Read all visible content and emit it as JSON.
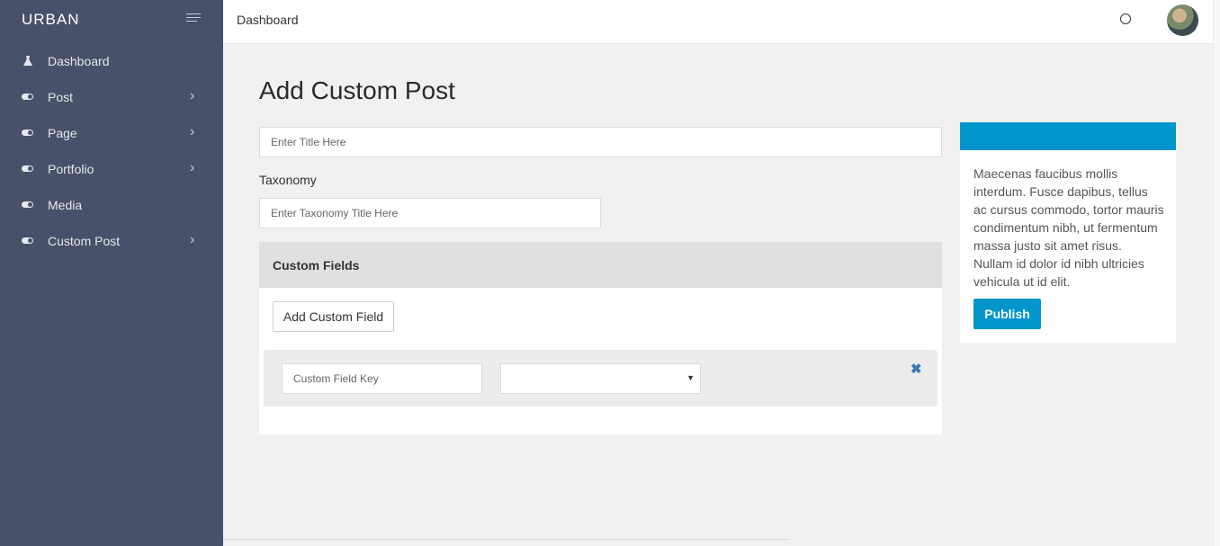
{
  "brand": "URBAN",
  "sidebar": {
    "items": [
      {
        "label": "Dashboard",
        "icon": "flask-icon",
        "has_submenu": false
      },
      {
        "label": "Post",
        "icon": "toggle-icon",
        "has_submenu": true
      },
      {
        "label": "Page",
        "icon": "toggle-icon",
        "has_submenu": true
      },
      {
        "label": "Portfolio",
        "icon": "toggle-icon",
        "has_submenu": true
      },
      {
        "label": "Media",
        "icon": "toggle-icon",
        "has_submenu": false
      },
      {
        "label": "Custom Post",
        "icon": "toggle-icon",
        "has_submenu": true
      }
    ],
    "chevron": "›"
  },
  "topbar": {
    "breadcrumb": "Dashboard"
  },
  "main": {
    "title": "Add Custom Post",
    "title_input": {
      "placeholder": "Enter Title Here",
      "value": ""
    },
    "taxonomy": {
      "label": "Taxonomy",
      "placeholder": "Enter Taxonomy Title Here",
      "value": ""
    },
    "custom_fields": {
      "header": "Custom Fields",
      "add_button": "Add Custom Field",
      "key_placeholder": "Custom Field Key",
      "select_value": "",
      "caret": "▼",
      "remove_glyph": "✖"
    }
  },
  "publish": {
    "description": "Maecenas faucibus mollis interdum. Fusce dapibus, tellus ac cursus commodo, tortor mauris condimentum nibh, ut fermentum massa justo sit amet risus. Nullam id dolor id nibh ultricies vehicula ut id elit.",
    "button": "Publish"
  },
  "colors": {
    "sidebar": "#475169",
    "accent": "#0295cc",
    "remove_icon": "#3b77b3"
  }
}
